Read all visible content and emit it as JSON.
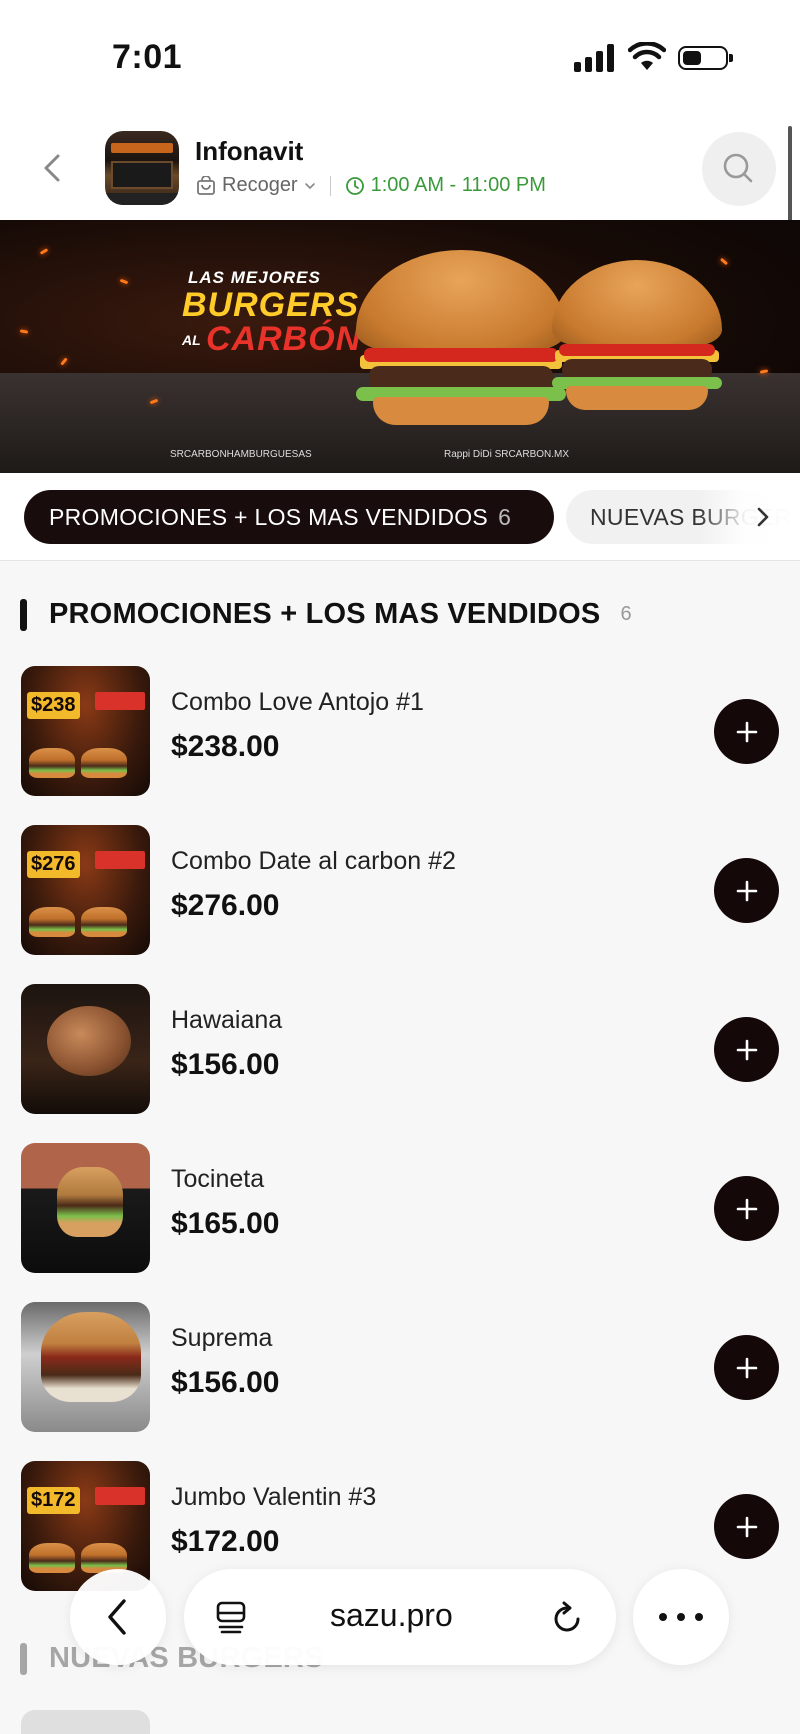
{
  "status_bar": {
    "time": "7:01"
  },
  "header": {
    "store_name": "Infonavit",
    "mode_label": "Recoger",
    "hours": "1:00 AM - 11:00 PM"
  },
  "banner": {
    "line1": "LAS MEJORES",
    "line2": "BURGERS",
    "line3_al": "AL",
    "line3": "CARBÓN",
    "footer_left": "SRCARBONHAMBURGUESAS",
    "footer_right": "Rappi   DiDi   SRCARBON.MX"
  },
  "categories": [
    {
      "label": "PROMOCIONES + LOS MAS VENDIDOS",
      "count": "6",
      "active": true
    },
    {
      "label": "NUEVAS BURGERS",
      "active": false
    }
  ],
  "section": {
    "title": "PROMOCIONES + LOS MAS VENDIDOS",
    "count": "6"
  },
  "items": [
    {
      "name": "Combo Love Antojo #1",
      "price": "$238.00",
      "thumb_tag": "$238"
    },
    {
      "name": "Combo Date al carbon #2",
      "price": "$276.00",
      "thumb_tag": "$276"
    },
    {
      "name": "Hawaiana",
      "price": "$156.00"
    },
    {
      "name": "Tocineta",
      "price": "$165.00"
    },
    {
      "name": "Suprema",
      "price": "$156.00"
    },
    {
      "name": "Jumbo Valentin #3",
      "price": "$172.00",
      "thumb_tag": "$172"
    }
  ],
  "next_section": {
    "title": "NUEVAS BURGERS"
  },
  "browser": {
    "url": "sazu.pro"
  },
  "colors": {
    "accent_dark": "#180c0c",
    "hours_green": "#3a9a3a",
    "banner_yellow": "#ffcc2a",
    "banner_red": "#e8322a"
  }
}
